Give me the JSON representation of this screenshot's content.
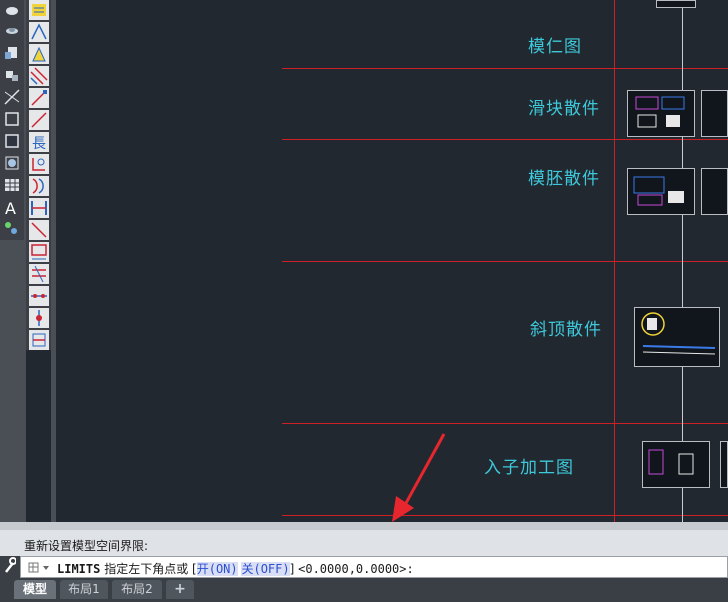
{
  "canvas": {
    "rows": [
      {
        "label": "模仁图"
      },
      {
        "label": "滑块散件"
      },
      {
        "label": "模胚散件"
      },
      {
        "label": "斜顶散件"
      },
      {
        "label": "入子加工图"
      }
    ]
  },
  "command": {
    "history": "重新设置模型空间界限:",
    "prompt_cmd": "LIMITS",
    "prompt_text": "指定左下角点或",
    "opt_open_bracket": "[",
    "opt_on_label": "开",
    "opt_on_key": "(ON)",
    "opt_off_label": "关",
    "opt_off_key": "(OFF)",
    "opt_close_bracket": "]",
    "default_value": "<0.0000,0.0000>:"
  },
  "tabs": [
    {
      "label": "模型",
      "active": true
    },
    {
      "label": "布局1",
      "active": false
    },
    {
      "label": "布局2",
      "active": false
    },
    {
      "label": "+",
      "active": false
    }
  ],
  "colors": {
    "canvas_bg": "#212830",
    "grid_line": "#cc1f26",
    "label_text": "#3ec8d9",
    "arrow": "#e8262d"
  }
}
